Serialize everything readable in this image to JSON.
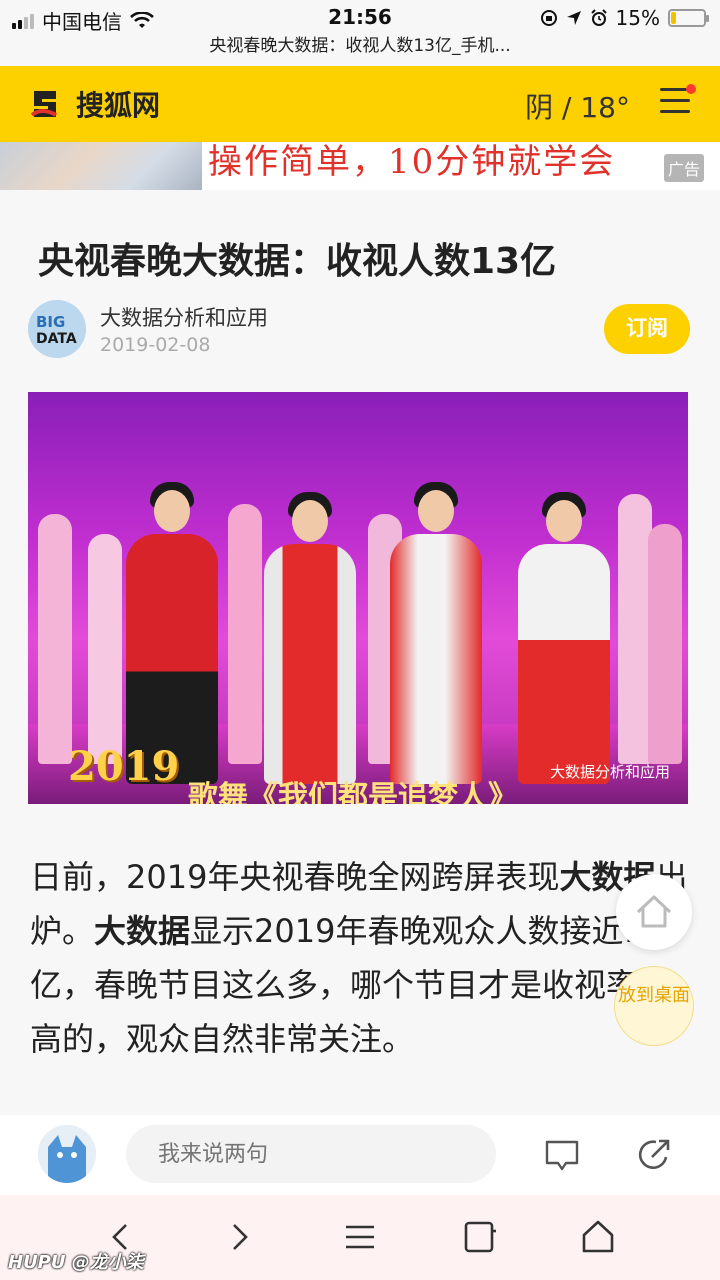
{
  "status_bar": {
    "carrier": "中国电信",
    "time": "21:56",
    "battery": "15%",
    "battery_level": 0.15
  },
  "url_bar": {
    "title": "央视春晚大数据：收视人数13亿_手机..."
  },
  "header": {
    "logo_text": "搜狐网",
    "weather": "阴 / 18°"
  },
  "ad": {
    "text": "操作简单，10分钟就学会",
    "tag": "广告"
  },
  "article": {
    "title": "央视春晚大数据：收视人数13亿",
    "author": "大数据分析和应用",
    "avatar_text": "BIG DATA",
    "date": "2019-02-08",
    "subscribe_label": "订阅",
    "image": {
      "year_mark": "2019",
      "watermark": "大数据分析和应用",
      "caption": "歌舞《我们都是追梦人》"
    },
    "body": [
      {
        "text": "日前，2019年央视春晚全网跨屏表现",
        "bold": false
      },
      {
        "text": "大数据",
        "bold": true
      },
      {
        "text": "出炉。",
        "bold": false
      },
      {
        "text": "大数据",
        "bold": true
      },
      {
        "text": "显示2019年春晚观众人数接近13亿，春晚节目这么多，哪个节目才是收视率最高的，观众自然非常关注。",
        "bold": false
      }
    ]
  },
  "floating": {
    "desktop_label": "放到桌面"
  },
  "comment_bar": {
    "placeholder": "我来说两句"
  },
  "watermark": "HUPU @龙小柒",
  "colors": {
    "brand_yellow": "#fdd000",
    "ad_red": "#e0322a",
    "toolbar_bg": "#fff2f2"
  }
}
